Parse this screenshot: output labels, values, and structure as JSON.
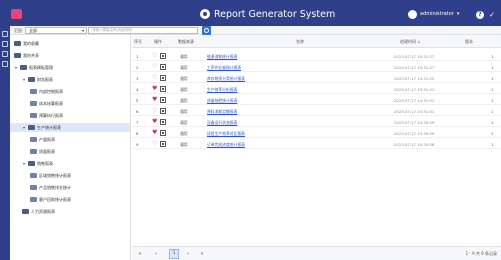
{
  "app": {
    "title": "Report Generator System",
    "user": "administrator",
    "help": "?",
    "brand_color": "#2f3f8a",
    "accent_color": "#e9457a"
  },
  "toolbar": {
    "label": "范围",
    "scope_value": "全部",
    "search_placeholder": "请输入模板名称/功能说明"
  },
  "tree": {
    "items": [
      {
        "label": "我的收藏",
        "level": 0,
        "icon": "folder-icon"
      },
      {
        "label": "我的共享",
        "level": 0,
        "icon": "folder-icon"
      },
      {
        "label": "报表模板管理",
        "level": 0,
        "icon": "folder-icon",
        "expander": "▾"
      },
      {
        "label": "财务报表",
        "level": 1,
        "icon": "folder-icon",
        "expander": "▾"
      },
      {
        "label": "内部控制报表",
        "level": 2,
        "icon": "folder-icon"
      },
      {
        "label": "成本核算报表",
        "level": 2,
        "icon": "folder-icon"
      },
      {
        "label": "预算执行报表",
        "level": 2,
        "icon": "folder-icon"
      },
      {
        "label": "生产统计报表",
        "level": 1,
        "icon": "folder-icon",
        "expander": "▾",
        "selected": true
      },
      {
        "label": "产量报表",
        "level": 2,
        "icon": "folder-icon"
      },
      {
        "label": "质量报表",
        "level": 2,
        "icon": "folder-icon"
      },
      {
        "label": "销售报表",
        "level": 1,
        "icon": "folder-icon",
        "expander": "▾"
      },
      {
        "label": "区域销售统计报表",
        "level": 2,
        "icon": "folder-icon"
      },
      {
        "label": "产品销售排名统计",
        "level": 2,
        "icon": "folder-icon"
      },
      {
        "label": "客户回款统计报表",
        "level": 2,
        "icon": "folder-icon"
      },
      {
        "label": "人力资源报表",
        "level": 1,
        "icon": "folder-icon"
      }
    ]
  },
  "grid": {
    "headers": {
      "num": "序号",
      "actions": "操作",
      "type": "数据来源",
      "name": "名称",
      "updated": "创建时间 ↓",
      "note": "版本"
    },
    "rows": [
      {
        "num": "1",
        "fav": false,
        "type": "通用",
        "name": "能源消耗统计报表",
        "updated": "2023-07-17 15:31:27",
        "note": "1"
      },
      {
        "num": "2",
        "fav": false,
        "type": "通用",
        "name": "工序作业量统计报表",
        "updated": "2023-07-17 15:31:27",
        "note": "1"
      },
      {
        "num": "3",
        "fav": false,
        "type": "通用",
        "name": "库存物资分类统计报表",
        "updated": "2023-07-17 15:31:22",
        "note": "1"
      },
      {
        "num": "4",
        "fav": true,
        "type": "通用",
        "name": "生产效率分析报表",
        "updated": "2023-07-17 15:31:21",
        "note": "1"
      },
      {
        "num": "5",
        "fav": true,
        "type": "通用",
        "name": "质量抽检统计报表",
        "updated": "2023-07-17 15:31:01",
        "note": "1"
      },
      {
        "num": "6",
        "fav": false,
        "type": "通用",
        "name": "原料消耗定额报表",
        "updated": "2023-07-17 15:31:01",
        "note": "1"
      },
      {
        "num": "7",
        "fav": true,
        "type": "通用",
        "name": "设备运行状态报表",
        "updated": "2023-07-17 15:30:59",
        "note": "1"
      },
      {
        "num": "8",
        "fav": true,
        "type": "通用",
        "name": "班组生产效率对比报表",
        "updated": "2023-07-17 15:30:59",
        "note": "1"
      },
      {
        "num": "9",
        "fav": false,
        "type": "通用",
        "name": "订单完成进度统计报表",
        "updated": "2023-07-17 15:30:58",
        "note": "1"
      }
    ]
  },
  "pager": {
    "first": "«",
    "prev": "‹",
    "current": "1",
    "next": "›",
    "last": "»",
    "info": "1 - 9 共 9 条记录"
  }
}
